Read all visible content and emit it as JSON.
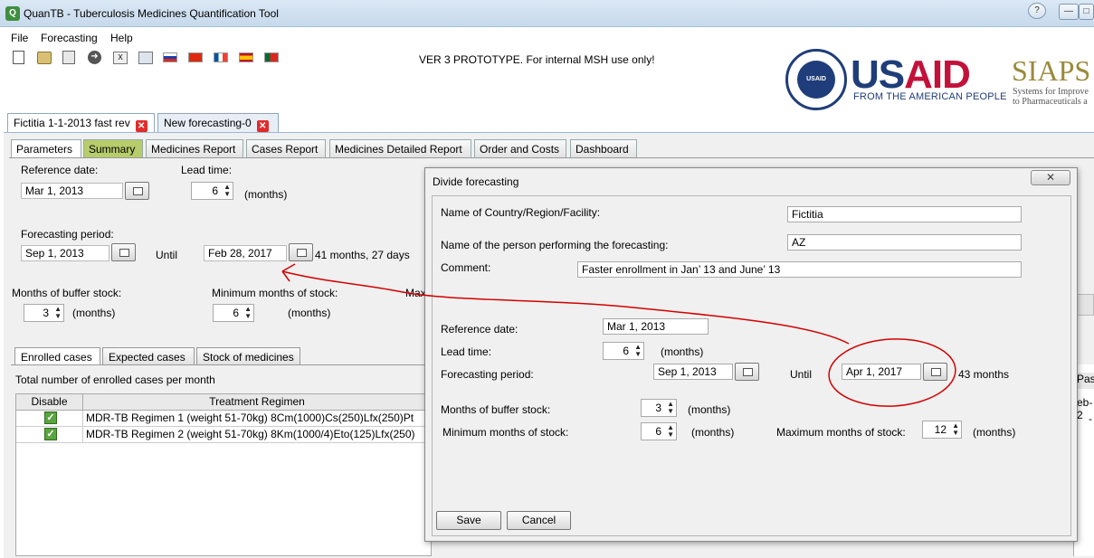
{
  "window": {
    "title": "QuanTB - Tuberculosis Medicines Quantification Tool",
    "logo_letter": "Q"
  },
  "menu": [
    "File",
    "Forecasting",
    "Help"
  ],
  "toolbar": {
    "icons": [
      "new-document-icon",
      "open-folder-icon",
      "save-disk-icon",
      "go-arrow-icon",
      "excel-export-icon",
      "window-icon"
    ],
    "flags": [
      "flag-en-icon",
      "flag-ru-icon",
      "flag-cn-icon",
      "flag-fr-icon",
      "flag-es-icon",
      "flag-pt-icon"
    ],
    "prototype_notice": "VER 3 PROTOTYPE. For internal MSH use only!"
  },
  "logos": {
    "usaid_us": "US",
    "usaid_aid": "AID",
    "usaid_tagline": "FROM THE AMERICAN PEOPLE",
    "usaid_seal": "USAID",
    "siaps": "SIAPS",
    "siaps_tag1": "Systems for Improve",
    "siaps_tag2": "to Pharmaceuticals a"
  },
  "doc_tabs": [
    "Fictitia 1-1-2013 fast rev",
    "New forecasting-0"
  ],
  "page_tabs": [
    "Parameters",
    "Summary",
    "Medicines Report",
    "Cases Report",
    "Medicines Detailed Report",
    "Order and Costs",
    "Dashboard"
  ],
  "params": {
    "reference_date_label": "Reference date:",
    "reference_date": "Mar 1, 2013",
    "lead_time_label": "Lead time:",
    "lead_time": "6",
    "months_unit": "(months)",
    "forecasting_period_label": "Forecasting period:",
    "period_start": "Sep 1, 2013",
    "until_label": "Until",
    "period_end": "Feb 28, 2017",
    "period_length": "41 months, 27 days",
    "buffer_label": "Months of buffer stock:",
    "buffer": "3",
    "min_label": "Minimum months of stock:",
    "min": "6",
    "max_label_partial": "Max"
  },
  "sub_tabs": [
    "Enrolled cases",
    "Expected cases",
    "Stock of medicines"
  ],
  "cases_table": {
    "caption": "Total number of enrolled cases per month",
    "headers": [
      "Disable",
      "Treatment Regimen"
    ],
    "rows": [
      {
        "disabled": true,
        "regimen": "MDR-TB Regimen 1 (weight 51-70kg)  8Cm(1000)Cs(250)Lfx(250)Pt"
      },
      {
        "disabled": true,
        "regimen": "MDR-TB Regimen 2 (weight 51-70kg)  8Km(1000/4)Eto(125)Lfx(250)"
      }
    ],
    "right_fragments": [
      "Pas",
      "eb-2",
      "-"
    ]
  },
  "dialog": {
    "title": "Divide forecasting",
    "close_glyph": "✕",
    "country_label": "Name of Country/Region/Facility:",
    "country": "Fictitia",
    "person_label": "Name of the person performing the forecasting:",
    "person": "AZ",
    "comment_label": "Comment:",
    "comment": "Faster enrollment in Jan’ 13 and June’ 13",
    "reference_date_label": "Reference date:",
    "reference_date": "Mar 1, 2013",
    "lead_time_label": "Lead time:",
    "lead_time": "6",
    "months_unit": "(months)",
    "forecasting_period_label": "Forecasting period:",
    "period_start": "Sep 1, 2013",
    "until_label": "Until",
    "period_end": "Apr 1, 2017",
    "period_length": "43 months",
    "buffer_label": "Months of buffer stock:",
    "buffer": "3",
    "min_label": "Minimum months of stock:",
    "min": "6",
    "max_label": "Maximum months of stock:",
    "max": "12",
    "save": "Save",
    "cancel": "Cancel"
  },
  "colors": {
    "summary_tab": "#b7cc6a",
    "annotation_red": "#d40000",
    "usaid_blue": "#1f3d7a",
    "usaid_red": "#c2113a"
  }
}
